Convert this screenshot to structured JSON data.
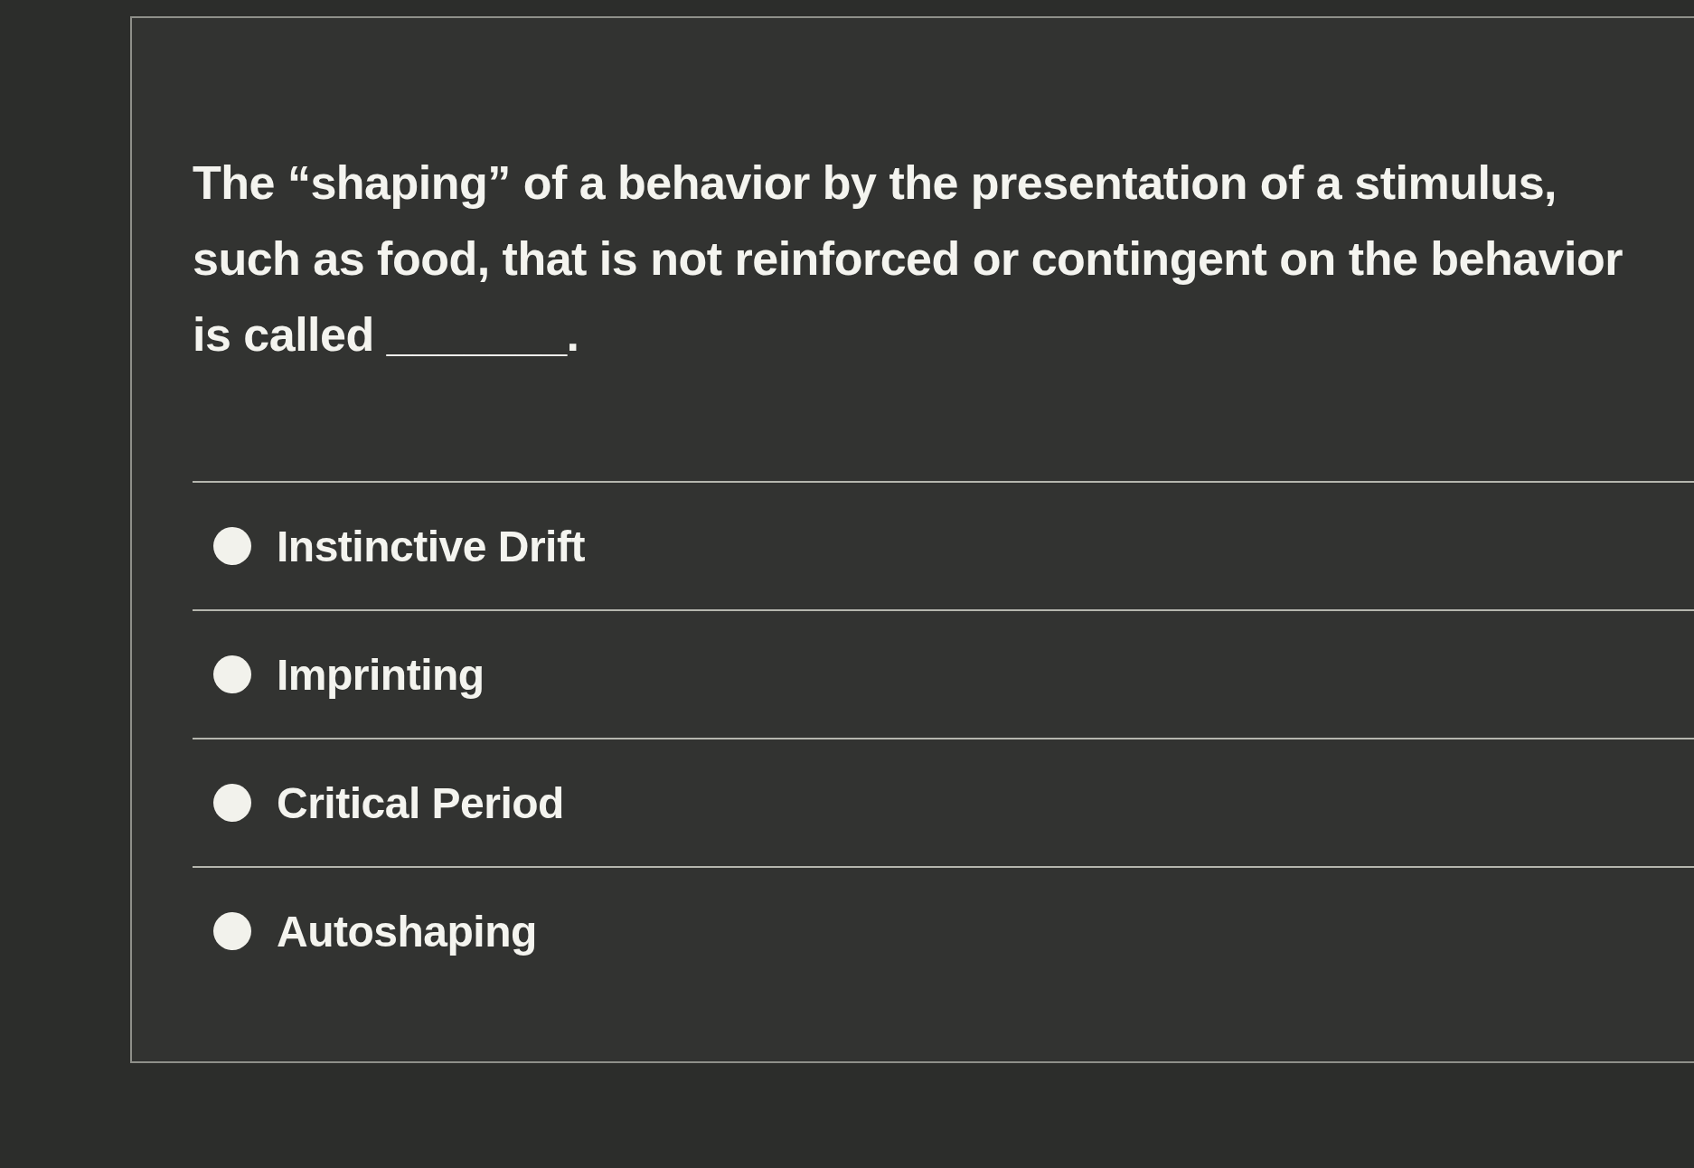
{
  "question": {
    "text": "The “shaping” of a behavior by the presentation of a stimulus, such as food, that is not reinforced or contingent on the behavior is called _______."
  },
  "answers": [
    {
      "label": "Instinctive Drift",
      "selected": false
    },
    {
      "label": "Imprinting",
      "selected": false
    },
    {
      "label": "Critical Period",
      "selected": false
    },
    {
      "label": "Autoshaping",
      "selected": false
    }
  ]
}
